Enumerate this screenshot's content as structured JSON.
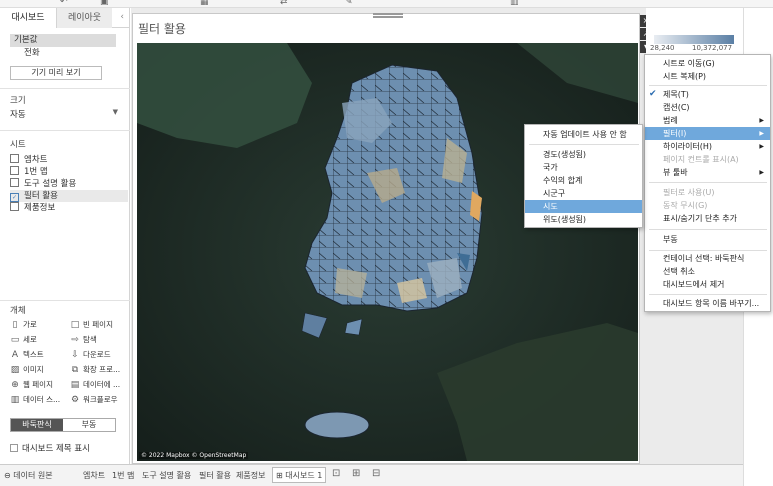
{
  "sidebar": {
    "tabs": [
      "대시보드",
      "레이아웃"
    ],
    "device": {
      "default": "기본값",
      "phone": "전화",
      "preview_button": "기기 미리 보기"
    },
    "size": {
      "title": "크기",
      "value": "자동"
    },
    "sheets": {
      "title": "시트",
      "items": [
        "엠차트",
        "1번 맵",
        "도구 설명 활용",
        "필터 활용",
        "제품정보"
      ]
    },
    "objects": {
      "title": "개체",
      "items": [
        {
          "label": "가로",
          "icon": "horizontal-icon"
        },
        {
          "label": "빈 페이지",
          "icon": "blank-icon"
        },
        {
          "label": "세로",
          "icon": "vertical-icon"
        },
        {
          "label": "탐색",
          "icon": "navigation-icon"
        },
        {
          "label": "텍스트",
          "icon": "text-icon"
        },
        {
          "label": "다운로드",
          "icon": "download-icon"
        },
        {
          "label": "이미지",
          "icon": "image-icon"
        },
        {
          "label": "확장 프로...",
          "icon": "extension-icon"
        },
        {
          "label": "웹 페이지",
          "icon": "globe-icon"
        },
        {
          "label": "데이터에 ...",
          "icon": "ask-data-icon"
        },
        {
          "label": "데이터 스...",
          "icon": "data-story-icon"
        },
        {
          "label": "워크플로우",
          "icon": "workflow-icon"
        }
      ]
    },
    "layout_toggle": {
      "tiled": "바둑판식",
      "floating": "부동"
    },
    "show_title": "대시보드 제목 표시"
  },
  "sheet": {
    "title": "필터 활용",
    "attribution": "© 2022 Mapbox © OpenStreetMap"
  },
  "legend": {
    "min": "28,240",
    "max": "10,372,077"
  },
  "context_menu": {
    "items": [
      {
        "label": "시트로 이동(G)"
      },
      {
        "label": "시트 복제(P)"
      },
      {
        "label": "제목(T)",
        "checked": true
      },
      {
        "label": "캡션(C)"
      },
      {
        "label": "범례",
        "submenu": true
      },
      {
        "label": "필터(I)",
        "submenu": true,
        "highlighted": true
      },
      {
        "label": "하이라이터(H)",
        "submenu": true
      },
      {
        "label": "페이지 컨트롤 표시(A)",
        "disabled": true
      },
      {
        "label": "뷰 툴바",
        "submenu": true
      },
      {
        "label": "필터로 사용(U)",
        "disabled": true
      },
      {
        "label": "동작 무시(G)",
        "disabled": true
      },
      {
        "label": "표시/숨기기 단추 추가"
      },
      {
        "label": "부동"
      },
      {
        "label": "컨테이너 선택: 바둑판식"
      },
      {
        "label": "선택 취소"
      },
      {
        "label": "대시보드에서 제거"
      },
      {
        "label": "대시보드 항목 이름 바꾸기..."
      }
    ]
  },
  "filter_submenu": {
    "items": [
      {
        "label": "자동 업데이트 사용 안 함"
      },
      {
        "label": "경도(생성됨)"
      },
      {
        "label": "국가"
      },
      {
        "label": "수익의 합계"
      },
      {
        "label": "시군구"
      },
      {
        "label": "시도",
        "highlighted": true
      },
      {
        "label": "위도(생성됨)"
      }
    ]
  },
  "bottom_bar": {
    "data_source": "데이터 원본",
    "tabs": [
      "엠차트",
      "1번 맵",
      "도구 설명 활용",
      "필터 활용",
      "제품정보",
      "대시보드 1"
    ],
    "active_tab": "대시보드 1"
  },
  "colors": {
    "menu_highlight": "#6fa8dc",
    "map_land": "#6d8fb0",
    "map_sea": "#1d2b25"
  }
}
